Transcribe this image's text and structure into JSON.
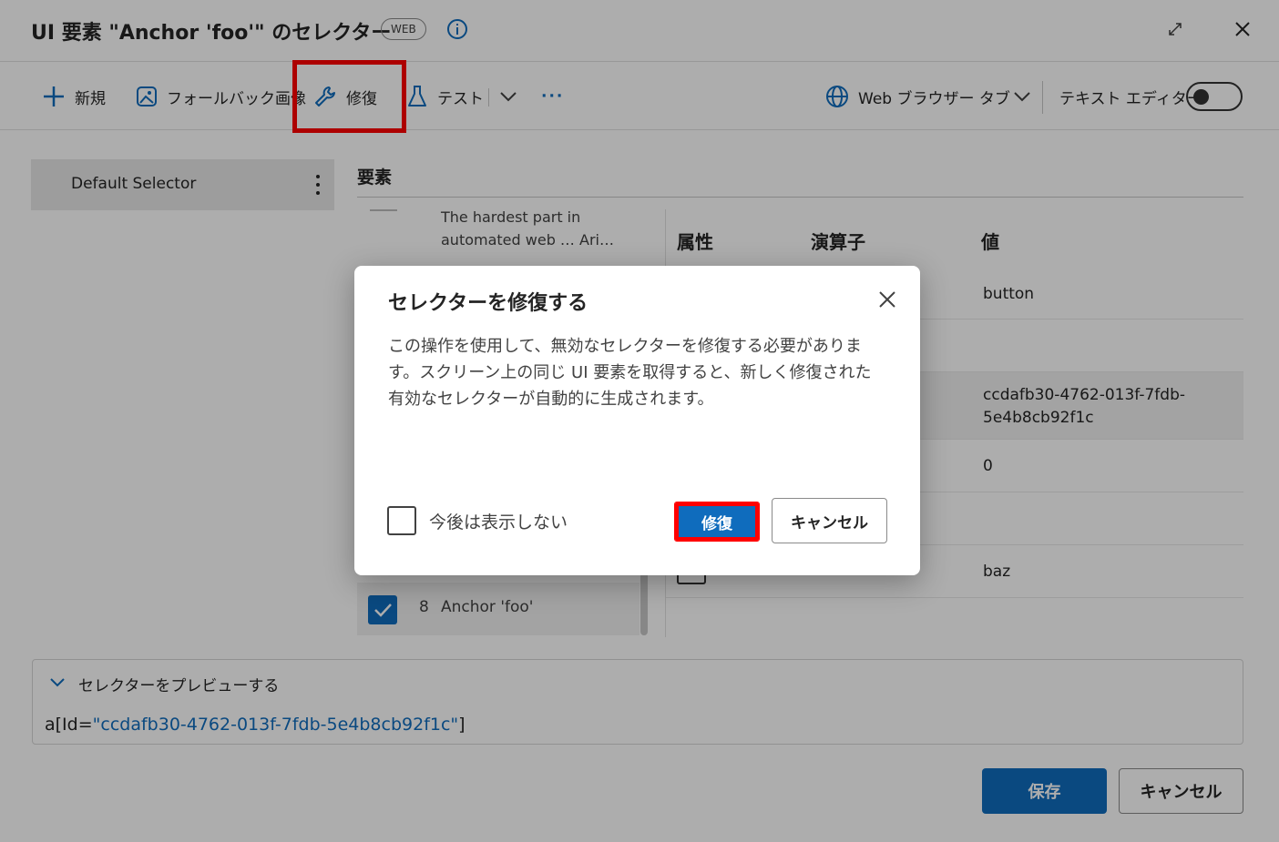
{
  "window": {
    "title": "UI 要素 \"Anchor 'foo'\" のセレクター",
    "badge": "WEB"
  },
  "toolbar": {
    "new_label": "新規",
    "fallback_label": "フォールバック画像",
    "repair_label": "修復",
    "test_label": "テスト",
    "more_label": "···",
    "browser_tab_label": "Web ブラウザー タブ",
    "text_editor_label": "テキスト エディター",
    "text_editor_on": false
  },
  "selectors": {
    "items": [
      {
        "label": "Default Selector"
      }
    ]
  },
  "elements": {
    "title": "要素",
    "first_item_desc": "The hardest part in automated web … Ari…",
    "selected_item": {
      "index": "8",
      "label": "Anchor 'foo'",
      "checked": true
    }
  },
  "attributes": {
    "headers": {
      "attribute": "属性",
      "operator": "演算子",
      "value": "値"
    },
    "values": [
      "button",
      "",
      "ccdafb30-4762-013f-7fdb-5e4b8cb92f1c",
      "0",
      "",
      "baz"
    ]
  },
  "preview": {
    "title": "セレクターをプレビューする",
    "code_prefix": "a[Id=",
    "code_value": "\"ccdafb30-4762-013f-7fdb-5e4b8cb92f1c\"",
    "code_suffix": "]"
  },
  "footer": {
    "save_label": "保存",
    "cancel_label": "キャンセル"
  },
  "dialog": {
    "title": "セレクターを修復する",
    "body": "この操作を使用して、無効なセレクターを修復する必要があります。スクリーン上の同じ UI 要素を取得すると、新しく修復された有効なセレクターが自動的に生成されます。",
    "checkbox_label": "今後は表示しない",
    "repair_label": "修復",
    "cancel_label": "キャンセル"
  },
  "colors": {
    "accent": "#0f6cbd",
    "highlight": "#ff0000"
  }
}
